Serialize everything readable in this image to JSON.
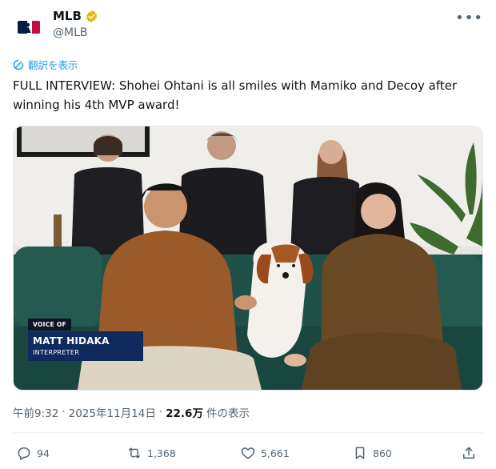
{
  "account": {
    "display_name": "MLB",
    "handle": "@MLB",
    "verified": true
  },
  "translate_label": "翻訳を表示",
  "post": {
    "text": "FULL INTERVIEW: Shohei Ohtani is all smiles with Mamiko and Decoy after winning his 4th MVP award!"
  },
  "video": {
    "lower_third": {
      "voice_label": "VOICE OF",
      "name": "MATT HIDAKA",
      "role": "INTERPRETER"
    }
  },
  "meta": {
    "time": "午前9:32",
    "date": "2025年11月14日",
    "separator": "·",
    "views_count": "22.6万",
    "views_label": "件の表示"
  },
  "actions": {
    "replies": "94",
    "reposts": "1,368",
    "likes": "5,661",
    "bookmarks": "860"
  },
  "colors": {
    "link": "#1d9bf0",
    "muted": "#536471",
    "verified_badge": "#e2b719",
    "lower_third_bg": "#0f2a5c"
  }
}
